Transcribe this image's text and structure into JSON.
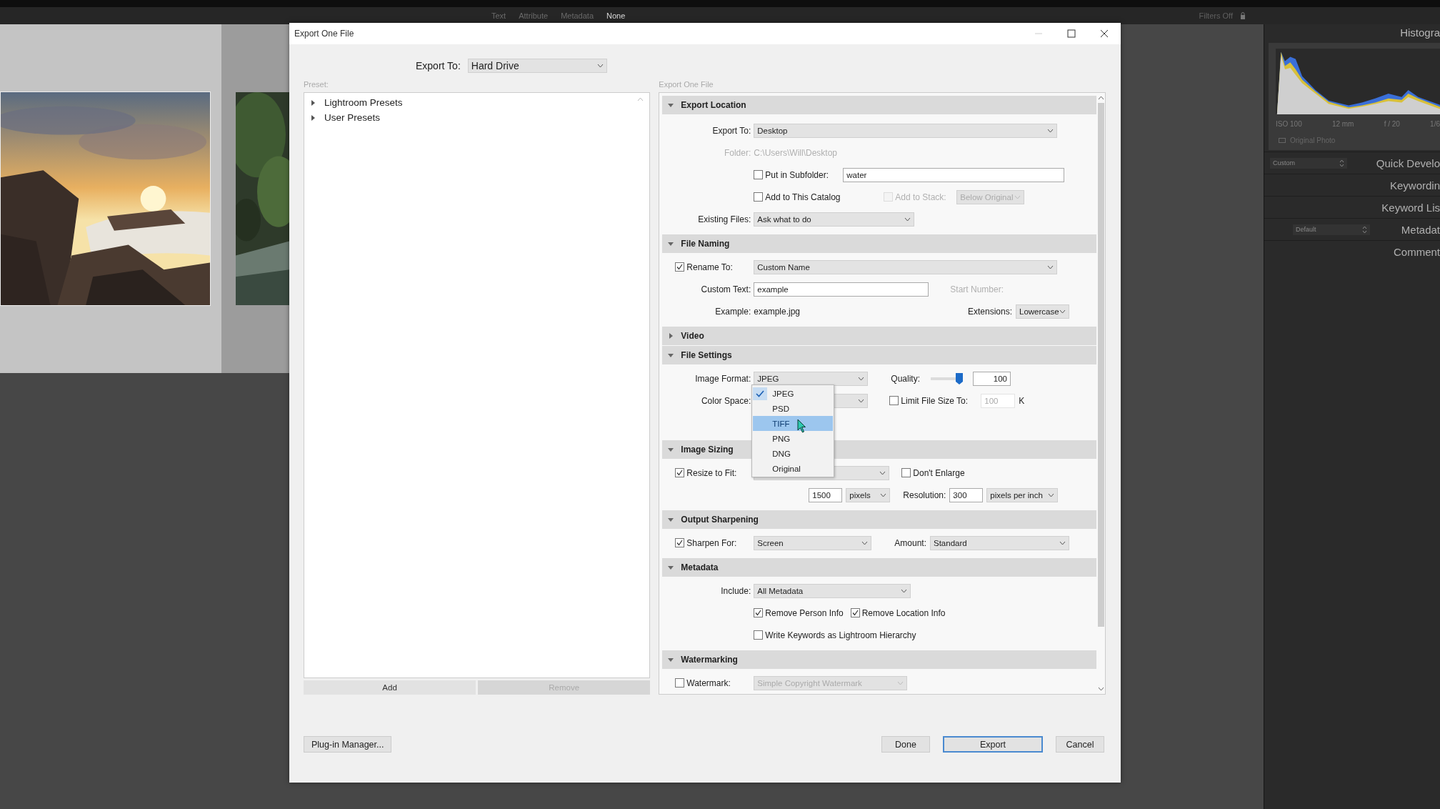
{
  "top_bar": {
    "filters": [
      {
        "label": "Text",
        "selected": false
      },
      {
        "label": "Attribute",
        "selected": false
      },
      {
        "label": "Metadata",
        "selected": false
      },
      {
        "label": "None",
        "selected": true
      }
    ],
    "filters_status": "Filters Off"
  },
  "right_panel": {
    "histogram_title": "Histogra",
    "exif": [
      "ISO 100",
      "12 mm",
      "f / 20",
      "1/6"
    ],
    "original_photo": "Original Photo",
    "panels": [
      {
        "title": "Quick Develo",
        "preset": "Custom"
      },
      {
        "title": "Keywordin"
      },
      {
        "title": "Keyword Lis"
      },
      {
        "title": "Metadat",
        "preset": "Default"
      },
      {
        "title": "Comment"
      }
    ]
  },
  "dialog": {
    "title": "Export One File",
    "export_to": {
      "label": "Export To:",
      "value": "Hard Drive"
    },
    "preset_label": "Preset:",
    "presets": [
      {
        "label": "Lightroom Presets",
        "expanded": false
      },
      {
        "label": "User Presets",
        "expanded": false
      }
    ],
    "add_button": "Add",
    "remove_button": {
      "label": "Remove",
      "disabled": true
    },
    "settings_label": "Export One File",
    "sections": [
      {
        "title": "Export Location",
        "expanded": true,
        "rows": [
          {
            "lead": {
              "kind": "label",
              "text": "Export To:"
            },
            "items": [
              {
                "kind": "select",
                "value": "Desktop"
              }
            ]
          },
          {
            "lead": {
              "kind": "label",
              "text": "Folder:",
              "disabled": true
            },
            "items": [
              {
                "kind": "text",
                "text": "C:\\Users\\Will\\Desktop",
                "disabled": true
              }
            ]
          },
          {
            "items": [
              {
                "kind": "checkbox",
                "text": "Put in Subfolder:",
                "checked": false
              },
              {
                "kind": "input",
                "value": "water"
              }
            ]
          },
          {
            "items": [
              {
                "kind": "checkbox",
                "text": "Add to This Catalog",
                "checked": false
              },
              {
                "kind": "checkbox",
                "text": "Add to Stack:",
                "checked": false,
                "disabled": true
              },
              {
                "kind": "select",
                "value": "Below Original",
                "disabled": true
              }
            ]
          },
          {
            "lead": {
              "kind": "label",
              "text": "Existing Files:"
            },
            "items": [
              {
                "kind": "select",
                "value": "Ask what to do"
              }
            ]
          }
        ]
      },
      {
        "title": "File Naming",
        "expanded": true,
        "rows": [
          {
            "lead": {
              "kind": "checkbox",
              "text": "Rename To:",
              "checked": true
            },
            "items": [
              {
                "kind": "select",
                "value": "Custom Name"
              }
            ]
          },
          {
            "lead": {
              "kind": "label",
              "text": "Custom Text:"
            },
            "items": [
              {
                "kind": "input",
                "value": "example"
              },
              {
                "kind": "text",
                "text": "Start Number:",
                "disabled": true
              }
            ]
          },
          {
            "lead": {
              "kind": "label",
              "text": "Example:"
            },
            "items": [
              {
                "kind": "text",
                "text": "example.jpg"
              },
              {
                "kind": "text",
                "text": "Extensions:"
              },
              {
                "kind": "select",
                "value": "Lowercase"
              }
            ]
          }
        ]
      },
      {
        "title": "Video",
        "expanded": false
      },
      {
        "title": "File Settings",
        "expanded": true,
        "rows": [
          {
            "lead": {
              "kind": "label",
              "text": "Image Format:"
            },
            "items": [
              {
                "kind": "select",
                "value": "JPEG"
              },
              {
                "kind": "text",
                "text": "Quality:"
              },
              {
                "kind": "slider",
                "level": 1.0
              },
              {
                "kind": "input",
                "value": "100"
              }
            ]
          },
          {
            "lead": {
              "kind": "label",
              "text": "Color Space:"
            },
            "items": [
              {
                "kind": "select"
              },
              {
                "kind": "checkbox",
                "text": "Limit File Size To:",
                "checked": false
              },
              {
                "kind": "input",
                "value": "100",
                "disabled": true
              },
              {
                "kind": "text",
                "text": "K"
              }
            ]
          }
        ]
      },
      {
        "title": "Image Sizing",
        "expanded": true,
        "rows": [
          {
            "lead": {
              "kind": "checkbox",
              "text": "Resize to Fit:",
              "checked": true
            },
            "items": [
              {
                "kind": "select"
              },
              {
                "kind": "checkbox",
                "text": "Don't Enlarge",
                "checked": false
              }
            ]
          },
          {
            "items": [
              {
                "kind": "input",
                "value": "1500"
              },
              {
                "kind": "select",
                "value": "pixels"
              },
              {
                "kind": "text",
                "text": "Resolution:"
              },
              {
                "kind": "input",
                "value": "300"
              },
              {
                "kind": "select",
                "value": "pixels per inch"
              }
            ]
          }
        ]
      },
      {
        "title": "Output Sharpening",
        "expanded": true,
        "rows": [
          {
            "lead": {
              "kind": "checkbox",
              "text": "Sharpen For:",
              "checked": true
            },
            "items": [
              {
                "kind": "select",
                "value": "Screen"
              },
              {
                "kind": "text",
                "text": "Amount:"
              },
              {
                "kind": "select",
                "value": "Standard"
              }
            ]
          }
        ]
      },
      {
        "title": "Metadata",
        "expanded": true,
        "rows": [
          {
            "lead": {
              "kind": "label",
              "text": "Include:"
            },
            "items": [
              {
                "kind": "select",
                "value": "All Metadata"
              }
            ]
          },
          {
            "items": [
              {
                "kind": "checkbox",
                "text": "Remove Person Info",
                "checked": true
              },
              {
                "kind": "checkbox",
                "text": "Remove Location Info",
                "checked": true
              }
            ]
          },
          {
            "items": [
              {
                "kind": "checkbox",
                "text": "Write Keywords as Lightroom Hierarchy",
                "checked": false
              }
            ]
          }
        ]
      },
      {
        "title": "Watermarking",
        "expanded": true,
        "rows": [
          {
            "lead": {
              "kind": "checkbox",
              "text": "Watermark:",
              "checked": false
            },
            "items": [
              {
                "kind": "select",
                "value": "Simple Copyright Watermark",
                "disabled": true
              }
            ]
          }
        ]
      }
    ],
    "format_menu": [
      {
        "label": "JPEG",
        "checked": true,
        "selected": false
      },
      {
        "label": "PSD",
        "checked": false,
        "selected": false
      },
      {
        "label": "TIFF",
        "checked": false,
        "selected": true
      },
      {
        "label": "PNG",
        "checked": false,
        "selected": false
      },
      {
        "label": "DNG",
        "checked": false,
        "selected": false
      },
      {
        "label": "Original",
        "checked": false,
        "selected": false
      }
    ],
    "plugin_manager": "Plug-in Manager...",
    "buttons": [
      {
        "label": "Done",
        "default": false
      },
      {
        "label": "Export",
        "default": true
      },
      {
        "label": "Cancel",
        "default": false
      }
    ]
  }
}
